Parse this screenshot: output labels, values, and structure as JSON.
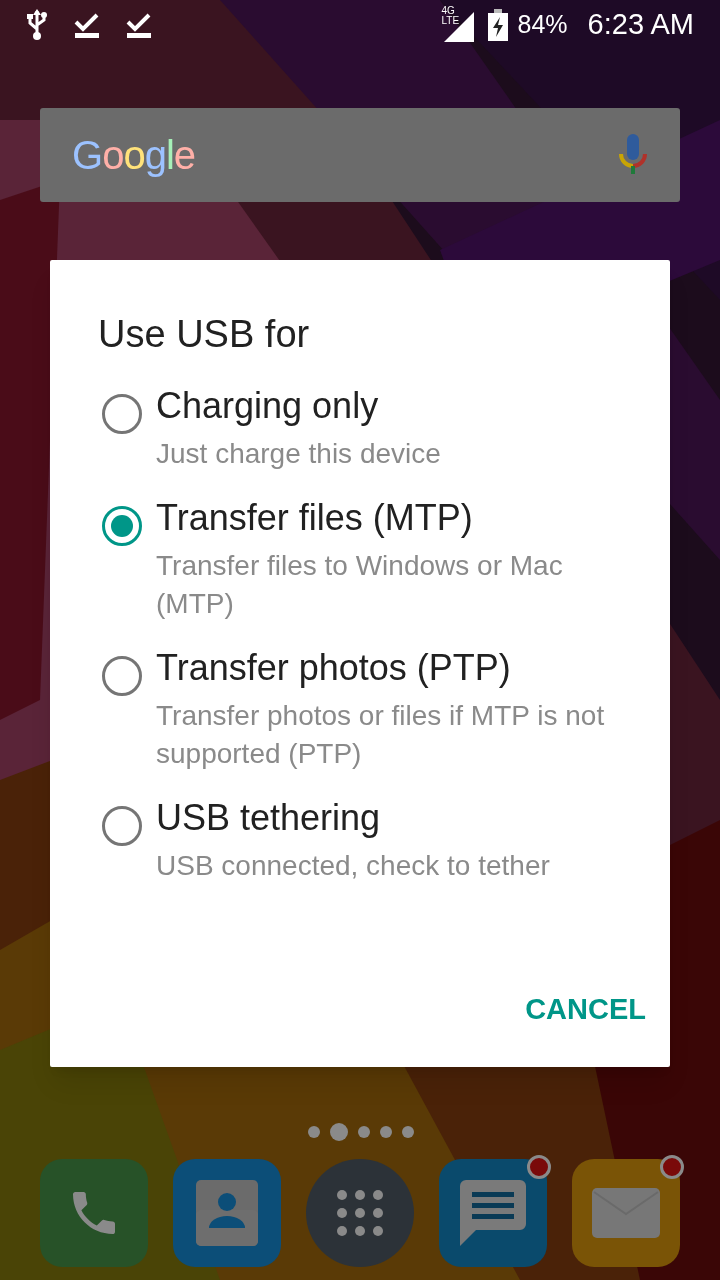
{
  "status_bar": {
    "notifications": [
      {
        "kind": "usb"
      },
      {
        "kind": "download"
      },
      {
        "kind": "download"
      }
    ],
    "network_top": "4G",
    "network_bottom": "LTE",
    "battery": "84%",
    "time": "6:23 AM"
  },
  "search_bar": {
    "logo": "Google"
  },
  "dialog": {
    "title": "Use USB for",
    "options": [
      {
        "label": "Charging only",
        "description": "Just charge this device",
        "selected": false
      },
      {
        "label": "Transfer files (MTP)",
        "description": "Transfer files to Windows or Mac (MTP)",
        "selected": true
      },
      {
        "label": "Transfer photos (PTP)",
        "description": "Transfer photos or files if MTP is not supported (PTP)",
        "selected": false
      },
      {
        "label": "USB tethering",
        "description": "USB connected, check to tether",
        "selected": false
      }
    ],
    "button": "CANCEL"
  },
  "page_dots": [
    {
      "selected": false
    },
    {
      "selected": true
    },
    {
      "selected": false
    },
    {
      "selected": false
    },
    {
      "selected": false
    }
  ],
  "dock": [
    {
      "kind": "phone",
      "badge": false
    },
    {
      "kind": "contacts",
      "badge": false
    },
    {
      "kind": "apps",
      "badge": false
    },
    {
      "kind": "messages",
      "badge": true
    },
    {
      "kind": "email",
      "badge": true
    }
  ]
}
